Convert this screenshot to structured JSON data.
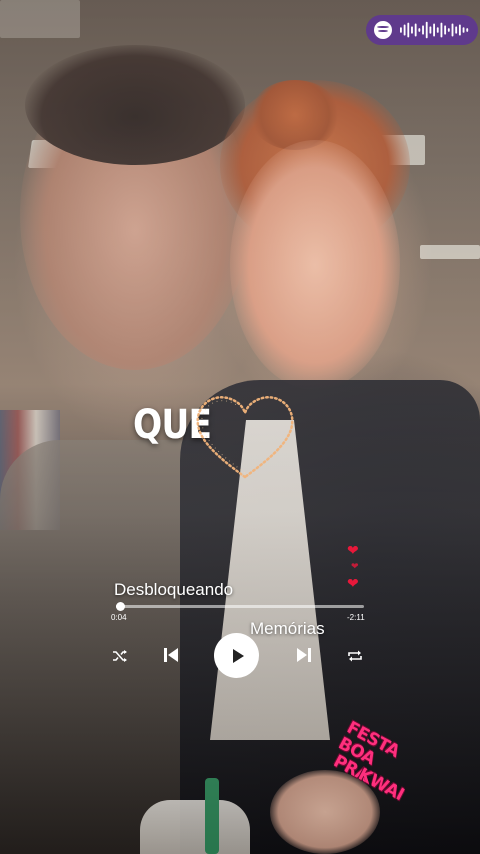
{
  "lyric": {
    "word": "QUE"
  },
  "spotify_code": {
    "icon": "spotify-icon",
    "color": "#5f3a8c"
  },
  "player": {
    "title": "Desbloqueando",
    "subtitle": "Memórias",
    "time_elapsed": "0:04",
    "time_remaining": "-2:11",
    "progress": 0.017,
    "controls": {
      "shuffle": "shuffle-icon",
      "previous": "skip-previous-icon",
      "play": "play-icon",
      "next": "skip-next-icon",
      "repeat": "repeat-icon"
    }
  },
  "reactions": {
    "icon": "heart-icon",
    "color": "#e8183a",
    "count": 3
  },
  "sticker": {
    "line1": "FESTA BOA",
    "line2": "PRA",
    "line3": "KWAI",
    "color": "#ff2f7d"
  }
}
